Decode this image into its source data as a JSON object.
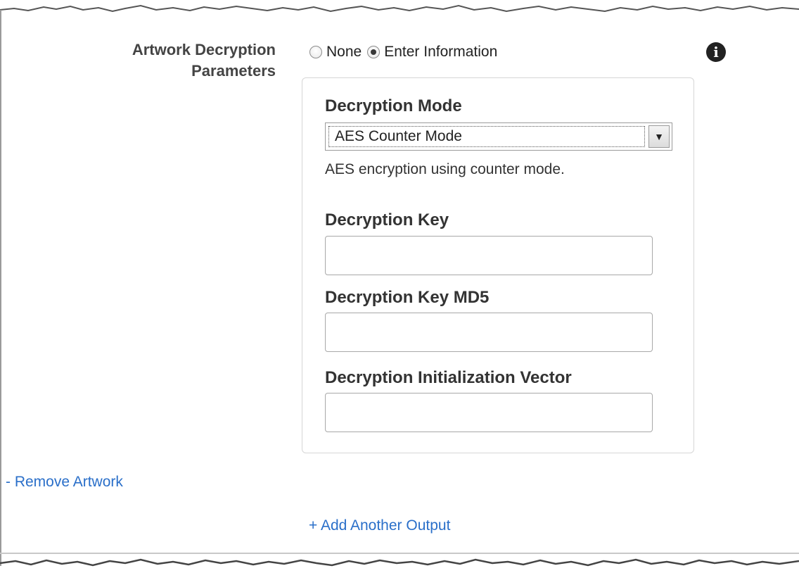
{
  "section": {
    "label_line1": "Artwork Decryption",
    "label_line2": "Parameters",
    "radio_none_label": "None",
    "radio_enter_label": "Enter Information",
    "selected": "Enter Information",
    "info_icon": "info-icon"
  },
  "panel": {
    "mode_label": "Decryption Mode",
    "mode_value": "AES Counter Mode",
    "mode_help": "AES encryption using counter mode.",
    "key_label": "Decryption Key",
    "key_value": "",
    "md5_label": "Decryption Key MD5",
    "md5_value": "",
    "iv_label": "Decryption Initialization Vector",
    "iv_value": ""
  },
  "links": {
    "remove_artwork": "- Remove Artwork",
    "add_output": "+ Add Another Output"
  },
  "colors": {
    "link": "#2a6fc9",
    "panel_border": "#d6d6d6"
  }
}
